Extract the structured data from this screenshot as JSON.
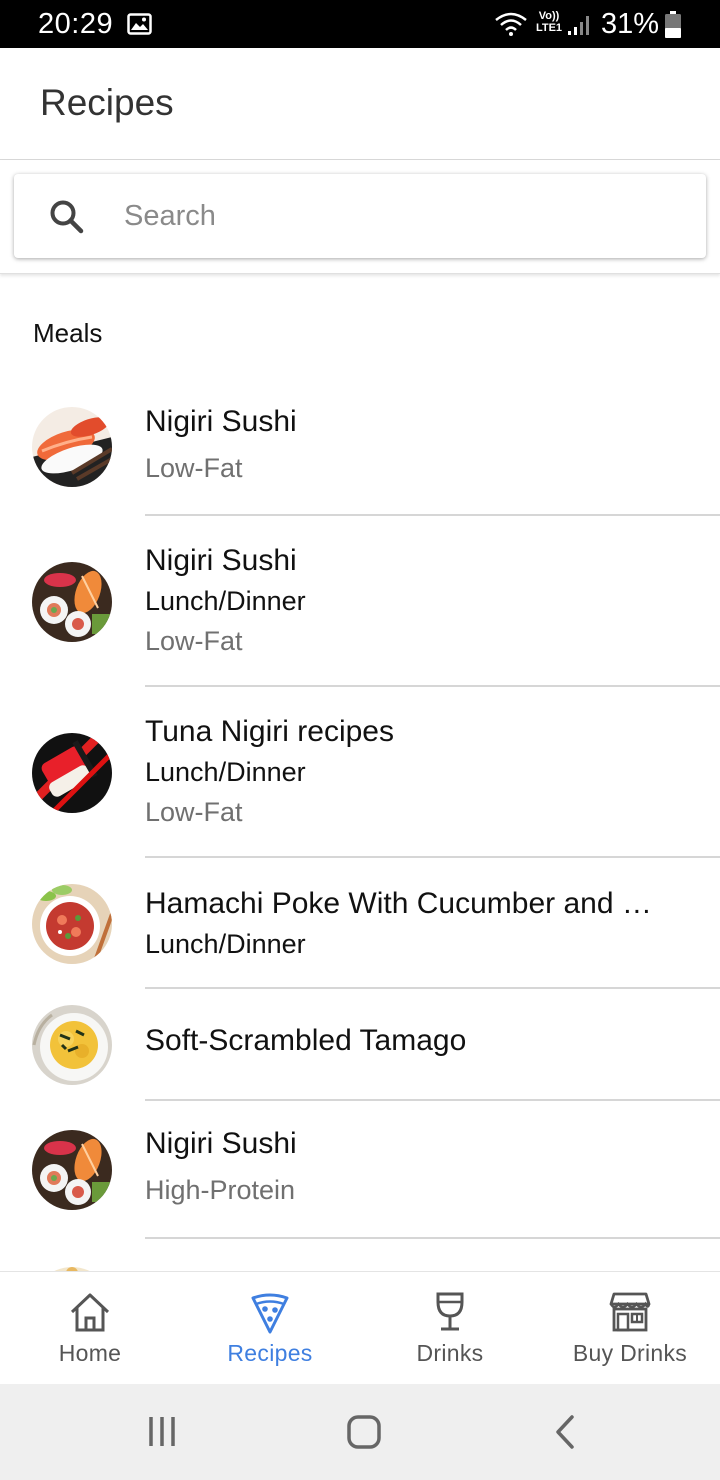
{
  "status_bar": {
    "time": "20:29",
    "network_label": "Vo))\nLTE1",
    "battery_percent": "31%"
  },
  "app_bar": {
    "title": "Recipes"
  },
  "search": {
    "placeholder": "Search",
    "value": ""
  },
  "section": {
    "title": "Meals"
  },
  "meals": [
    {
      "title": "Nigiri Sushi",
      "subtitle": "",
      "tag": "Low-Fat",
      "image_icon": "nigiri-sushi-image"
    },
    {
      "title": "Nigiri Sushi",
      "subtitle": "Lunch/Dinner",
      "tag": "Low-Fat",
      "image_icon": "sushi-platter-image"
    },
    {
      "title": "Tuna Nigiri recipes",
      "subtitle": "Lunch/Dinner",
      "tag": "Low-Fat",
      "image_icon": "tuna-nigiri-image"
    },
    {
      "title": "Hamachi Poke With Cucumber and Sesame",
      "subtitle": "Lunch/Dinner",
      "tag": "",
      "image_icon": "poke-bowl-image"
    },
    {
      "title": "Soft-Scrambled Tamago",
      "subtitle": "",
      "tag": "",
      "image_icon": "tamago-image"
    },
    {
      "title": "Nigiri Sushi",
      "subtitle": "",
      "tag": "High-Protein",
      "image_icon": "sushi-platter-image"
    }
  ],
  "bottom_nav": {
    "active": "Recipes",
    "items": [
      {
        "label": "Home",
        "icon": "home-icon"
      },
      {
        "label": "Recipes",
        "icon": "pizza-slice-icon"
      },
      {
        "label": "Drinks",
        "icon": "wine-glass-icon"
      },
      {
        "label": "Buy Drinks",
        "icon": "store-icon"
      }
    ]
  },
  "colors": {
    "accent": "#3f7fe0",
    "divider": "#d6d6d6",
    "secondary_text": "#707070"
  }
}
